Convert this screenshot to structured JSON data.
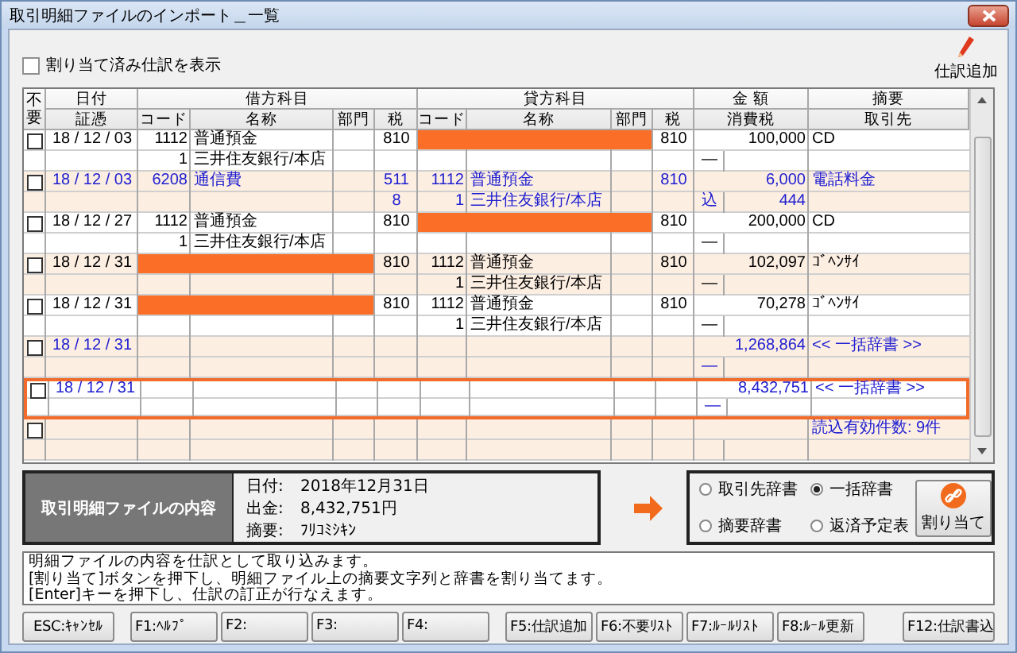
{
  "window": {
    "title": "取引明細ファイルのインポート＿一覧"
  },
  "toolbar": {
    "show_assigned": {
      "label": "割り当て済み仕訳を表示",
      "checked": false
    },
    "add_button": "仕訳追加"
  },
  "table": {
    "header_top": [
      "不要",
      "日付",
      "借方科目",
      "貸方科目",
      "金 額",
      "摘要"
    ],
    "header_bottom": [
      "証憑",
      "コード",
      "名称",
      "部門",
      "税",
      "コード",
      "名称",
      "部門",
      "税",
      "消費税",
      "取引先"
    ],
    "entries": [
      {
        "unneeded": false,
        "assigned": false,
        "selected": false,
        "date": "18 / 12 / 03",
        "dr": {
          "missing": false,
          "code": "1112",
          "name": "普通預金",
          "tax": "810",
          "sub_code": "1",
          "sub_name": "三井住友銀行/本店"
        },
        "cr": {
          "missing": true,
          "tax": "810"
        },
        "amount": "100,000",
        "tax_mark": "—",
        "summary": "CD"
      },
      {
        "unneeded": false,
        "assigned": true,
        "selected": false,
        "date": "18 / 12 / 03",
        "dr": {
          "missing": false,
          "code": "6208",
          "name": "通信費",
          "tax": "511",
          "tax_rate": "8"
        },
        "cr": {
          "missing": false,
          "code": "1112",
          "name": "普通預金",
          "tax": "810",
          "sub_code": "1",
          "sub_name": "三井住友銀行/本店"
        },
        "amount": "6,000",
        "tax_mark": "込",
        "tax_amount": "444",
        "summary": "電話料金"
      },
      {
        "unneeded": false,
        "assigned": false,
        "selected": false,
        "date": "18 / 12 / 27",
        "dr": {
          "missing": false,
          "code": "1112",
          "name": "普通預金",
          "tax": "810",
          "sub_code": "1",
          "sub_name": "三井住友銀行/本店"
        },
        "cr": {
          "missing": true,
          "tax": "810"
        },
        "amount": "200,000",
        "tax_mark": "—",
        "summary": "CD"
      },
      {
        "unneeded": false,
        "assigned": false,
        "selected": false,
        "date": "18 / 12 / 31",
        "dr": {
          "missing": true,
          "tax": "810"
        },
        "cr": {
          "missing": false,
          "code": "1112",
          "name": "普通預金",
          "tax": "810",
          "sub_code": "1",
          "sub_name": "三井住友銀行/本店"
        },
        "amount": "102,097",
        "tax_mark": "—",
        "summary": "ｺﾞﾍﾝｻｲ"
      },
      {
        "unneeded": false,
        "assigned": false,
        "selected": false,
        "date": "18 / 12 / 31",
        "dr": {
          "missing": true,
          "tax": "810"
        },
        "cr": {
          "missing": false,
          "code": "1112",
          "name": "普通預金",
          "tax": "810",
          "sub_code": "1",
          "sub_name": "三井住友銀行/本店"
        },
        "amount": "70,278",
        "tax_mark": "—",
        "summary": "ｺﾞﾍﾝｻｲ"
      },
      {
        "unneeded": false,
        "assigned": true,
        "selected": false,
        "date": "18 / 12 / 31",
        "amount": "1,268,864",
        "tax_mark": "—",
        "summary": "<< 一括辞書 >>"
      },
      {
        "unneeded": false,
        "assigned": true,
        "selected": true,
        "date": "18 / 12 / 31",
        "amount": "8,432,751",
        "tax_mark": "—",
        "summary": "<< 一括辞書 >>"
      },
      {
        "unneeded": false,
        "assigned": true,
        "selected": false,
        "summary": "読込有効件数: 9件"
      }
    ]
  },
  "detail": {
    "title": "取引明細ファイルの内容",
    "fields": [
      {
        "label": "日付:",
        "value": "2018年12月31日"
      },
      {
        "label": "出金:",
        "value": "8,432,751円"
      },
      {
        "label": "摘要:",
        "value": "ﾌﾘｺﾐｼｷﾝ"
      }
    ]
  },
  "dictionaries": [
    {
      "label": "取引先辞書",
      "selected": false
    },
    {
      "label": "一括辞書",
      "selected": true
    },
    {
      "label": "摘要辞書",
      "selected": false
    },
    {
      "label": "返済予定表",
      "selected": false
    }
  ],
  "assign_button": "割り当て",
  "description": [
    "明細ファイルの内容を仕訳として取り込みます。",
    "[割り当て]ボタンを押下し、明細ファイル上の摘要文字列と辞書を割り当てます。",
    "[Enter]キーを押下し、仕訳の訂正が行なえます。"
  ],
  "function_key_groups": [
    [
      "ESC:ｷｬﾝｾﾙ"
    ],
    [
      "F1:ﾍﾙﾌﾟ",
      "F2:",
      "F3:",
      "F4:"
    ],
    [
      "F5:仕訳追加",
      "F6:不要ﾘｽﾄ",
      "F7:ﾙｰﾙﾘｽﾄ",
      "F8:ﾙｰﾙ更新"
    ],
    [
      "F12:仕訳書込"
    ]
  ]
}
